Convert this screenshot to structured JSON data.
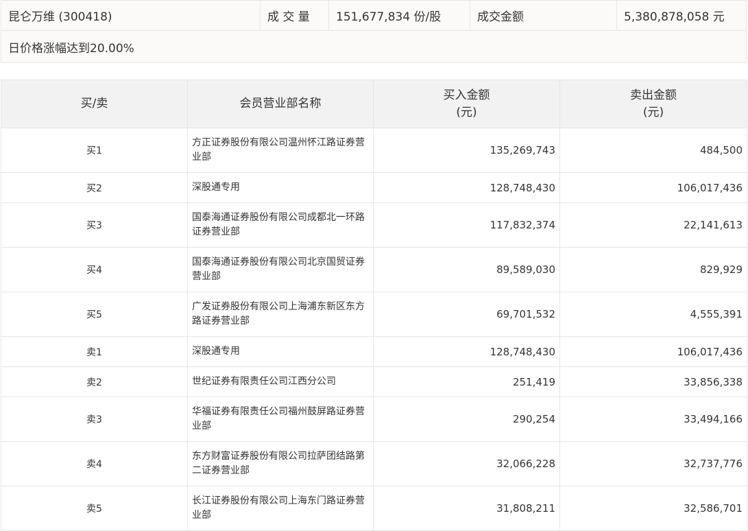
{
  "summary": {
    "stock_name": "昆仑万维 (300418)",
    "volume_label": "成 交 量",
    "volume_value": "151,677,834 份/股",
    "amount_label": "成交金额",
    "amount_value": "5,380,878,058 元",
    "reason": "日价格涨幅达到20.00%"
  },
  "table": {
    "headers": {
      "side": "买/卖",
      "name": "会员营业部名称",
      "buy_line1": "买入金额",
      "buy_line2": "(元)",
      "sell_line1": "卖出金额",
      "sell_line2": "(元)"
    },
    "rows": [
      {
        "side": "买1",
        "name": "方正证券股份有限公司温州怀江路证券营业部",
        "buy": "135,269,743",
        "sell": "484,500"
      },
      {
        "side": "买2",
        "name": "深股通专用",
        "buy": "128,748,430",
        "sell": "106,017,436"
      },
      {
        "side": "买3",
        "name": "国泰海通证券股份有限公司成都北一环路证券营业部",
        "buy": "117,832,374",
        "sell": "22,141,613"
      },
      {
        "side": "买4",
        "name": "国泰海通证券股份有限公司北京国贸证券营业部",
        "buy": "89,589,030",
        "sell": "829,929"
      },
      {
        "side": "买5",
        "name": "广发证券股份有限公司上海浦东新区东方路证券营业部",
        "buy": "69,701,532",
        "sell": "4,555,391"
      },
      {
        "side": "卖1",
        "name": "深股通专用",
        "buy": "128,748,430",
        "sell": "106,017,436"
      },
      {
        "side": "卖2",
        "name": "世纪证券有限责任公司江西分公司",
        "buy": "251,419",
        "sell": "33,856,338"
      },
      {
        "side": "卖3",
        "name": "华福证券有限责任公司福州鼓屏路证券营业部",
        "buy": "290,254",
        "sell": "33,494,166"
      },
      {
        "side": "卖4",
        "name": "东方财富证券股份有限公司拉萨团结路第二证券营业部",
        "buy": "32,066,228",
        "sell": "32,737,776"
      },
      {
        "side": "卖5",
        "name": "长江证券股份有限公司上海东门路证券营业部",
        "buy": "31,808,211",
        "sell": "32,586,701"
      }
    ]
  }
}
